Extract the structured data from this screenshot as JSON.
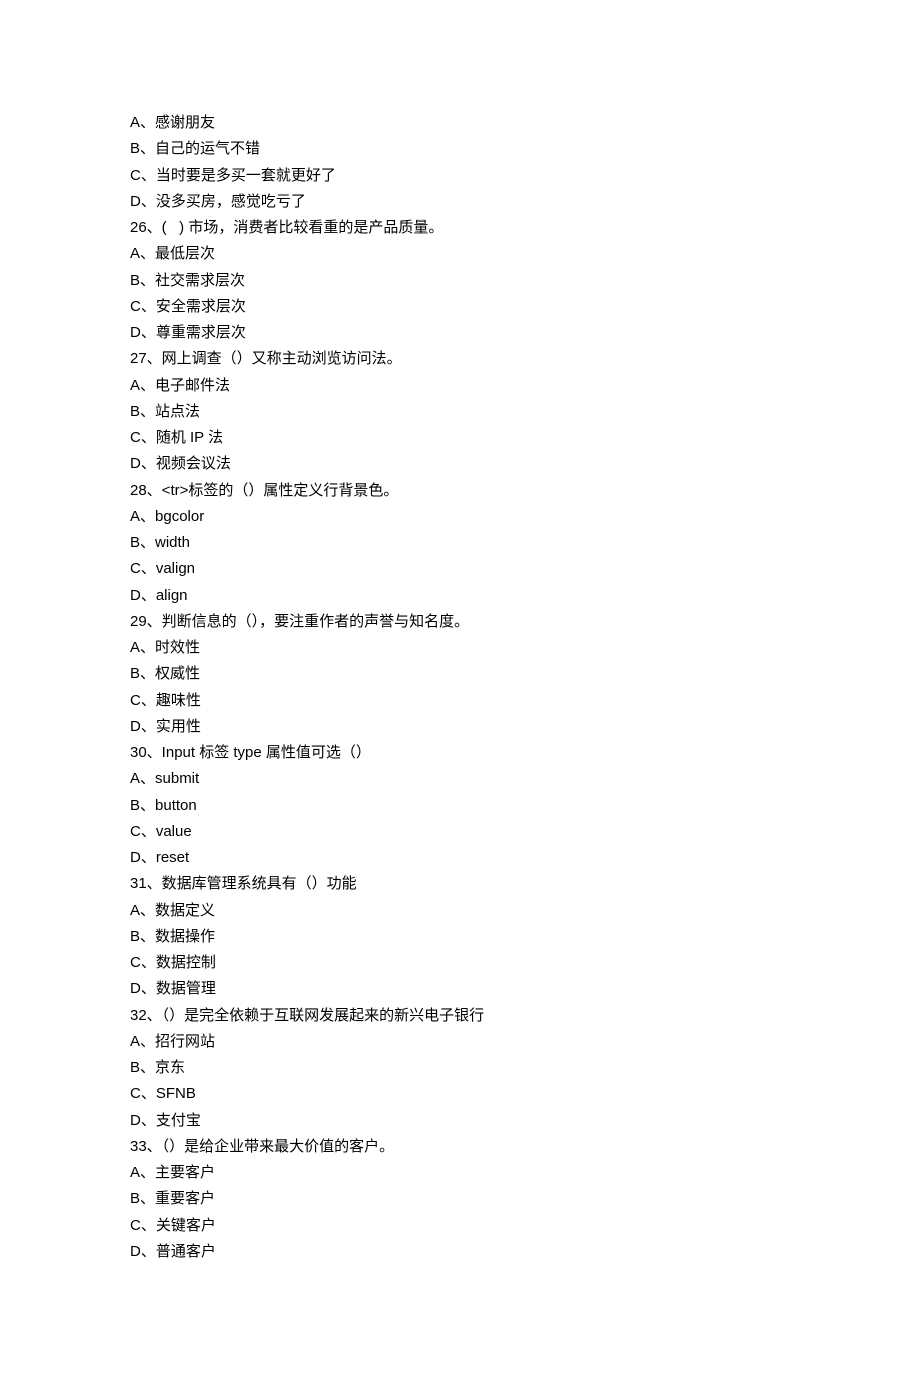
{
  "lines": [
    "A、感谢朋友",
    "B、自己的运气不错",
    "C、当时要是多买一套就更好了",
    "D、没多买房，感觉吃亏了",
    "26、(   ) 市场，消费者比较看重的是产品质量。",
    "A、最低层次",
    "B、社交需求层次",
    "C、安全需求层次",
    "D、尊重需求层次",
    "27、网上调查（）又称主动浏览访问法。",
    "A、电子邮件法",
    "B、站点法",
    "C、随机 IP 法",
    "D、视频会议法",
    "28、<tr>标签的（）属性定义行背景色。",
    "A、bgcolor",
    "B、width",
    "C、valign",
    "D、align",
    "29、判断信息的（），要注重作者的声誉与知名度。",
    "A、时效性",
    "B、权威性",
    "C、趣味性",
    "D、实用性",
    "30、Input 标签 type 属性值可选（）",
    "A、submit",
    "B、button",
    "C、value",
    "D、reset",
    "31、数据库管理系统具有（）功能",
    "A、数据定义",
    "B、数据操作",
    "C、数据控制",
    "D、数据管理",
    "32、（）是完全依赖于互联网发展起来的新兴电子银行",
    "A、招行网站",
    "B、京东",
    "C、SFNB",
    "D、支付宝",
    "33、（）是给企业带来最大价值的客户。",
    "A、主要客户",
    "B、重要客户",
    "C、关键客户",
    "D、普通客户"
  ]
}
